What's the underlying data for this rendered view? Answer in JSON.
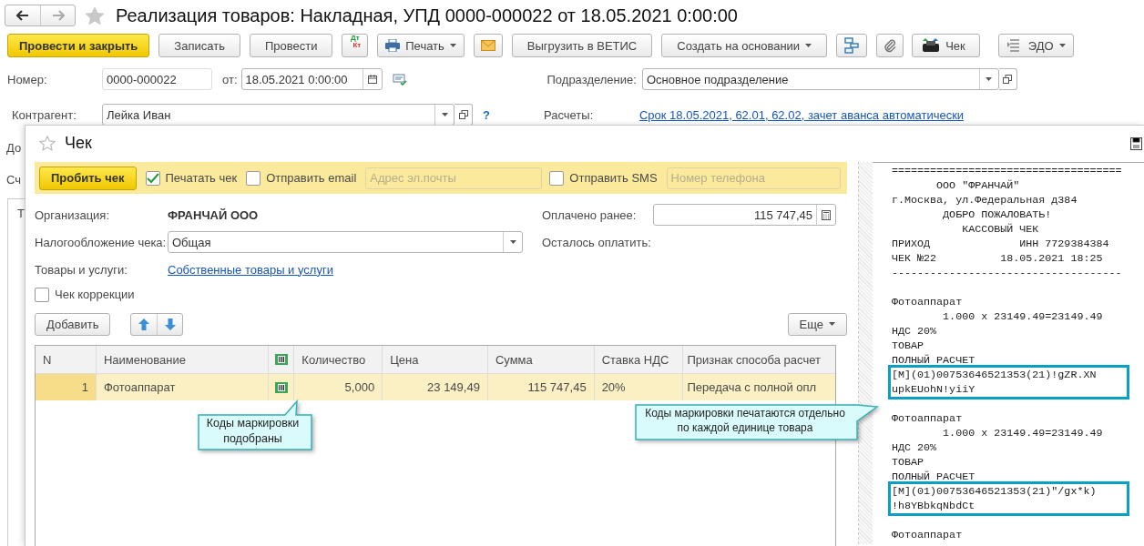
{
  "window": {
    "title": "Реализация товаров: Накладная, УПД 0000-000022 от 18.05.2021 0:00:00"
  },
  "toolbar": [
    {
      "kind": "primary",
      "label": "Провести и закрыть"
    },
    {
      "kind": "plain",
      "label": "Записать"
    },
    {
      "kind": "plain",
      "label": "Провести"
    },
    {
      "kind": "dtkt",
      "top": "Дт",
      "bottom": "Кт"
    },
    {
      "kind": "print",
      "label": "Печать",
      "menu": true
    },
    {
      "kind": "mail"
    },
    {
      "kind": "plain",
      "label": "Выгрузить в ВЕТИС"
    },
    {
      "kind": "plain",
      "label": "Создать на основании",
      "menu": true
    },
    {
      "kind": "structure"
    },
    {
      "kind": "clip"
    },
    {
      "kind": "receipt",
      "label": "Чек"
    },
    {
      "kind": "edo",
      "label": "ЭДО",
      "menu": true
    }
  ],
  "header": {
    "number_label": "Номер:",
    "number": "0000-000022",
    "date_label": "от:",
    "date": "18.05.2021  0:00:00",
    "division_label": "Подразделение:",
    "division": "Основное подразделение",
    "counterparty_label": "Контрагент:",
    "counterparty": "Лейка Иван",
    "help": "?",
    "settlements_label": "Расчеты:",
    "settlements_link": "Срок 18.05.2021, 62.01, 62.02, зачет аванса автоматически"
  },
  "hidden_fragments": [
    "До",
    "Сч",
    "Т"
  ],
  "dialog": {
    "title": "Чек",
    "action_bar": {
      "button": "Пробить чек",
      "print": {
        "label": "Печатать чек",
        "checked": true
      },
      "email": {
        "label": "Отправить email",
        "checked": false,
        "placeholder": "Адрес эл.почты"
      },
      "sms": {
        "label": "Отправить SMS",
        "checked": false,
        "placeholder": "Номер телефона"
      }
    },
    "organization_label": "Организация:",
    "organization": "ФРАНЧАЙ ООО",
    "taxation_label": "Налогообложение чека:",
    "taxation": "Общая",
    "goods_label": "Товары и услуги:",
    "goods_link": "Собственные товары и услуги",
    "correction": {
      "label": "Чек коррекции",
      "checked": false
    },
    "paid_label": "Оплачено ранее:",
    "paid": "115 747,45",
    "remaining_label": "Осталось оплатить:",
    "table_toolbar": {
      "add": "Добавить",
      "more": "Еще"
    },
    "columns": [
      {
        "kind": "num",
        "label": "N"
      },
      {
        "kind": "text",
        "label": "Наименование"
      },
      {
        "kind": "mark"
      },
      {
        "kind": "num",
        "label": "Количество"
      },
      {
        "kind": "num",
        "label": "Цена"
      },
      {
        "kind": "num",
        "label": "Сумма"
      },
      {
        "kind": "text",
        "label": "Ставка НДС"
      },
      {
        "kind": "text",
        "label": "Признак способа расчет"
      }
    ],
    "rows": [
      {
        "selected": true,
        "n": "1",
        "name": "Фотоаппарат",
        "codes_picked": true,
        "quantity": "5,000",
        "price": "23 149,49",
        "sum": "115 747,45",
        "vat": "20%",
        "payment_method": "Передача с полной опл"
      }
    ],
    "callouts": [
      "Коды маркировки подобраны",
      "Коды маркировки печатаются отдельно по каждой единице товара"
    ],
    "receipt": [
      {
        "kind": "text",
        "text": "===================================="
      },
      {
        "kind": "text",
        "text": "       ООО \"ФРАНЧАЙ\""
      },
      {
        "kind": "text",
        "text": "г.Москва, ул.Федеральная д384"
      },
      {
        "kind": "text",
        "text": "        ДОБРО ПОЖАЛОВАТЬ!"
      },
      {
        "kind": "text",
        "text": "           КАССОВЫЙ ЧЕК"
      },
      {
        "kind": "text",
        "text": "ПРИХОД              ИНН 7729384384"
      },
      {
        "kind": "text",
        "text": "ЧЕК №22          18.05.2021 18:25"
      },
      {
        "kind": "text",
        "text": "------------------------------------"
      },
      {
        "kind": "gap"
      },
      {
        "kind": "text",
        "text": "Фотоаппарат"
      },
      {
        "kind": "text",
        "text": "        1.000 x 23149.49=23149.49"
      },
      {
        "kind": "text",
        "text": "НДС 20%"
      },
      {
        "kind": "text",
        "text": "ТОВАР"
      },
      {
        "kind": "text",
        "text": "ПОЛНЫЙ РАСЧЕТ"
      },
      {
        "kind": "code",
        "lines": [
          "[M](01)00753646521353(21)!gZR.XN",
          "upkEUohN!yiiY"
        ]
      },
      {
        "kind": "gap"
      },
      {
        "kind": "text",
        "text": "Фотоаппарат"
      },
      {
        "kind": "text",
        "text": "        1.000 x 23149.49=23149.49"
      },
      {
        "kind": "text",
        "text": "НДС 20%"
      },
      {
        "kind": "text",
        "text": "ТОВАР"
      },
      {
        "kind": "text",
        "text": "ПОЛНЫЙ РАСЧЕТ"
      },
      {
        "kind": "code",
        "lines": [
          "[M](01)00753646521353(21)\"/gx*k)",
          "!h8YBbkqNbdCt"
        ]
      },
      {
        "kind": "gap"
      },
      {
        "kind": "text",
        "text": "Фотоаппарат"
      }
    ]
  }
}
